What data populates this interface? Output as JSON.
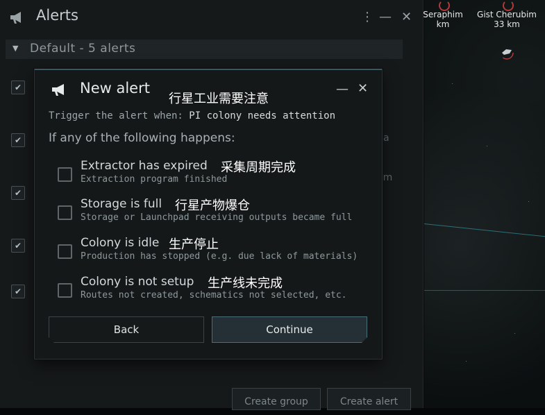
{
  "space": {
    "ships": [
      {
        "name": "Seraphim",
        "distance": "km"
      },
      {
        "name": "Gist Cherubim",
        "distance": "33 km"
      }
    ]
  },
  "alerts_window": {
    "title": "Alerts",
    "group": {
      "label": "Default - 5 alerts"
    },
    "background_rows": [
      {
        "checked": "✔"
      },
      {
        "checked": "✔",
        "right_text": "a"
      },
      {
        "checked": "✔",
        "right_text": "om"
      },
      {
        "checked": "✔"
      },
      {
        "checked": "✔"
      }
    ],
    "buttons": {
      "create_group": "Create group",
      "create_alert": "Create alert"
    }
  },
  "modal": {
    "title": "New alert",
    "title_annotation": "行星工业需要注意",
    "trigger_label": "Trigger the alert when: ",
    "trigger_value": "PI colony needs attention",
    "subheading": "If any of the following happens:",
    "options": [
      {
        "title": "Extractor has expired",
        "annotation": "采集周期完成",
        "description": "Extraction program finished",
        "checked": false
      },
      {
        "title": "Storage is full",
        "annotation": "行星产物爆仓",
        "description": "Storage or Launchpad receiving outputs became full",
        "checked": false
      },
      {
        "title": "Colony is idle",
        "annotation": "生产停止",
        "description": "Production has stopped (e.g. due lack of materials)",
        "checked": false
      },
      {
        "title": "Colony is not setup",
        "annotation": "生产线未完成",
        "description": "Routes not created, schematics not selected, etc.",
        "checked": false
      }
    ],
    "buttons": {
      "back": "Back",
      "continue": "Continue"
    }
  },
  "icons": {
    "alerts_window": "megaphone-icon",
    "modal": "megaphone-icon"
  },
  "colors": {
    "accent": "#3b5860",
    "continue_border": "#4b6f78",
    "hostile_marker": "#b13a3a"
  }
}
